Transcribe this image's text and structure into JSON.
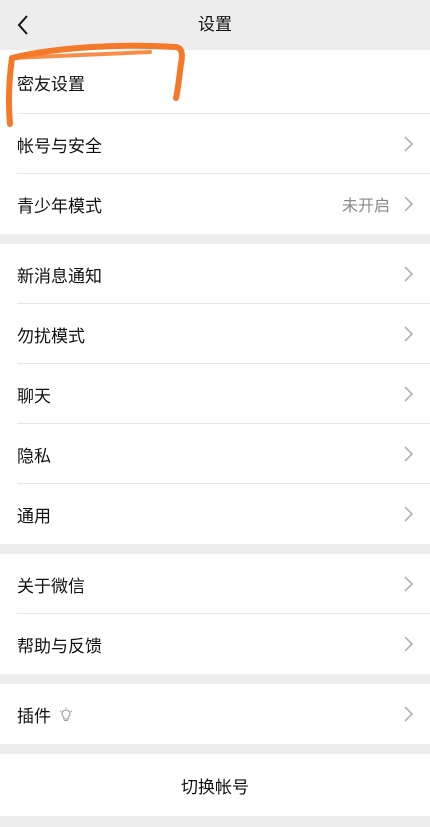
{
  "nav": {
    "title": "设置",
    "back_icon": "chevron-left-icon"
  },
  "group1": [
    {
      "label": "密友设置",
      "value": ""
    },
    {
      "label": "帐号与安全",
      "value": ""
    },
    {
      "label": "青少年模式",
      "value": "未开启"
    }
  ],
  "group2": [
    {
      "label": "新消息通知"
    },
    {
      "label": "勿扰模式"
    },
    {
      "label": "聊天"
    },
    {
      "label": "隐私"
    },
    {
      "label": "通用"
    }
  ],
  "group3": [
    {
      "label": "关于微信"
    },
    {
      "label": "帮助与反馈"
    }
  ],
  "group4": [
    {
      "label": "插件",
      "icon": "lightbulb-icon"
    }
  ],
  "switch_account": {
    "label": "切换帐号"
  },
  "colors": {
    "annotation": "#f47a2a",
    "chevron": "#b2b2b2",
    "background": "#ededed"
  }
}
